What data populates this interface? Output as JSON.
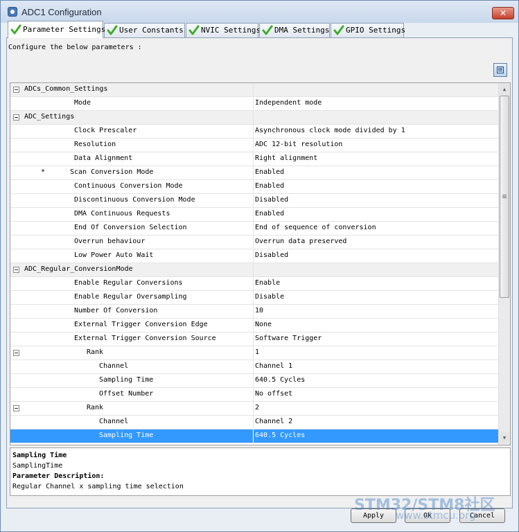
{
  "window": {
    "title": "ADC1 Configuration",
    "close_label": "✕"
  },
  "tabs": [
    {
      "label": "Parameter Settings",
      "active": true
    },
    {
      "label": "User Constants",
      "active": false
    },
    {
      "label": "NVIC Settings",
      "active": false
    },
    {
      "label": "DMA Settings",
      "active": false
    },
    {
      "label": "GPIO Settings",
      "active": false
    }
  ],
  "colors": {
    "check": "#3fae2a",
    "selection": "#3399ff",
    "group_row": "#f0f0f0"
  },
  "configure_text": "Configure the below parameters :",
  "tree": {
    "rows": [
      {
        "type": "group",
        "name": "ADCs_Common_Settings",
        "value": ""
      },
      {
        "type": "param",
        "name": "Mode",
        "value": "Independent mode"
      },
      {
        "type": "group",
        "name": "ADC_Settings",
        "value": ""
      },
      {
        "type": "param",
        "name": "Clock Prescaler",
        "value": "Asynchronous clock mode divided by 1"
      },
      {
        "type": "param",
        "name": "Resolution",
        "value": "ADC 12-bit resolution"
      },
      {
        "type": "param",
        "name": "Data Alignment",
        "value": "Right alignment"
      },
      {
        "type": "param",
        "name": "Scan Conversion Mode",
        "value": "Enabled",
        "modified": true
      },
      {
        "type": "param",
        "name": "Continuous Conversion Mode",
        "value": "Enabled"
      },
      {
        "type": "param",
        "name": "Discontinuous Conversion Mode",
        "value": "Disabled"
      },
      {
        "type": "param",
        "name": "DMA Continuous Requests",
        "value": "Enabled"
      },
      {
        "type": "param",
        "name": "End Of Conversion Selection",
        "value": "End of sequence of conversion"
      },
      {
        "type": "param",
        "name": "Overrun behaviour",
        "value": "Overrun data preserved"
      },
      {
        "type": "param",
        "name": "Low Power Auto Wait",
        "value": "Disabled"
      },
      {
        "type": "group",
        "name": "ADC_Regular_ConversionMode",
        "value": ""
      },
      {
        "type": "param",
        "name": "Enable Regular Conversions",
        "value": "Enable"
      },
      {
        "type": "param",
        "name": "Enable Regular Oversampling",
        "value": "Disable"
      },
      {
        "type": "param",
        "name": "Number Of Conversion",
        "value": "10"
      },
      {
        "type": "param",
        "name": "External Trigger Conversion Edge",
        "value": "None"
      },
      {
        "type": "param",
        "name": "External Trigger Conversion Source",
        "value": "Software Trigger"
      },
      {
        "type": "rank",
        "name": "Rank",
        "value": "1"
      },
      {
        "type": "sub",
        "name": "Channel",
        "value": "Channel 1"
      },
      {
        "type": "sub",
        "name": "Sampling Time",
        "value": "640.5 Cycles"
      },
      {
        "type": "sub",
        "name": "Offset Number",
        "value": "No offset"
      },
      {
        "type": "rank",
        "name": "Rank",
        "value": "2"
      },
      {
        "type": "sub",
        "name": "Channel",
        "value": "Channel 2"
      },
      {
        "type": "sub",
        "name": "Sampling Time",
        "value": "640.5 Cycles",
        "selected": true
      }
    ],
    "modified_marker": "*"
  },
  "description": {
    "title": "Sampling Time",
    "id": "SamplingTime",
    "heading": "Parameter Description:",
    "text": "Regular Channel x sampling time selection"
  },
  "buttons": {
    "apply": "Apply",
    "ok": "Ok",
    "cancel": "Cancel"
  },
  "watermark": {
    "main": "STM32/STM8社区",
    "sub": "www.stmcu.org"
  }
}
